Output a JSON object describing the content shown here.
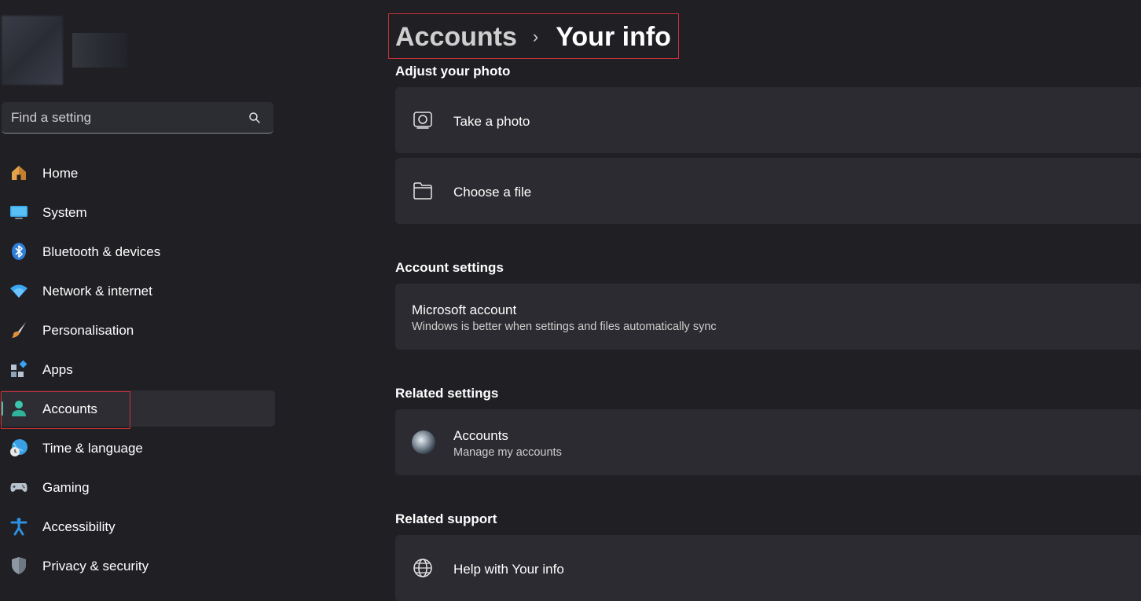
{
  "sidebar": {
    "search": {
      "placeholder": "Find a setting",
      "icon": "search-icon"
    },
    "items": [
      {
        "label": "Home",
        "icon": "home-icon"
      },
      {
        "label": "System",
        "icon": "monitor-icon"
      },
      {
        "label": "Bluetooth & devices",
        "icon": "bluetooth-icon"
      },
      {
        "label": "Network & internet",
        "icon": "wifi-icon"
      },
      {
        "label": "Personalisation",
        "icon": "brush-icon"
      },
      {
        "label": "Apps",
        "icon": "apps-icon"
      },
      {
        "label": "Accounts",
        "icon": "person-icon",
        "selected": true
      },
      {
        "label": "Time & language",
        "icon": "globe-clock-icon"
      },
      {
        "label": "Gaming",
        "icon": "gamepad-icon"
      },
      {
        "label": "Accessibility",
        "icon": "accessibility-icon"
      },
      {
        "label": "Privacy & security",
        "icon": "shield-icon"
      }
    ]
  },
  "header": {
    "breadcrumb_parent": "Accounts",
    "breadcrumb_separator": "›",
    "breadcrumb_current": "Your info"
  },
  "sections": {
    "adjust_photo": {
      "title": "Adjust your photo",
      "items": [
        {
          "label": "Take a photo",
          "icon": "camera-icon"
        },
        {
          "label": "Choose a file",
          "icon": "folder-icon"
        }
      ]
    },
    "account_settings": {
      "title": "Account settings",
      "items": [
        {
          "label": "Microsoft account",
          "description": "Windows is better when settings and files automatically sync"
        }
      ]
    },
    "related_settings": {
      "title": "Related settings",
      "items": [
        {
          "label": "Accounts",
          "description": "Manage my accounts",
          "icon": "avatar-icon"
        }
      ]
    },
    "related_support": {
      "title": "Related support",
      "items": [
        {
          "label": "Help with Your info",
          "icon": "globe-icon"
        }
      ]
    }
  },
  "colors": {
    "background": "#1f1f24",
    "card": "#2b2b31",
    "accent": "#4cc2b0",
    "highlight": "#c8323a"
  }
}
